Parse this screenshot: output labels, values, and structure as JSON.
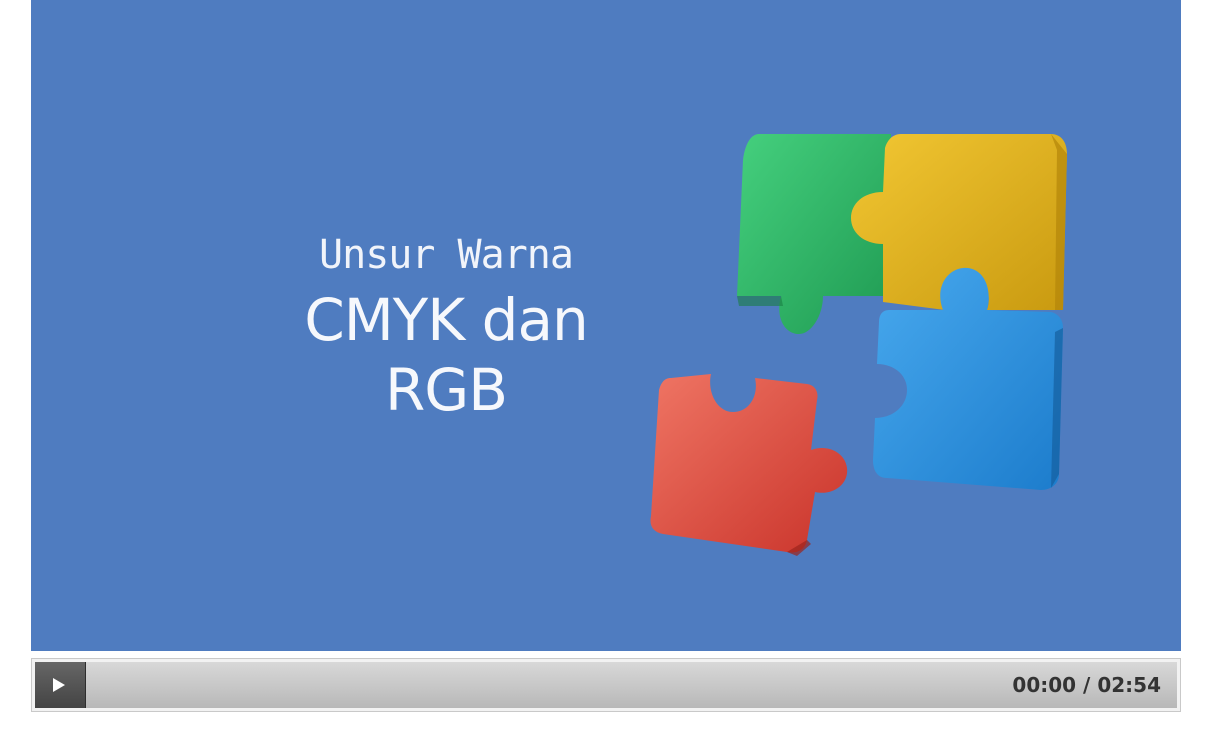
{
  "video": {
    "subtitle": "Unsur Warna",
    "title": "CMYK dan RGB",
    "background_color": "#4f7cc0",
    "graphic": {
      "icon": "puzzle-pieces",
      "piece_colors": [
        "#2fb86a",
        "#e3b21a",
        "#2f93e2",
        "#e0473a"
      ]
    }
  },
  "controls": {
    "play_icon": "play-icon",
    "current_time": "00:00",
    "separator": "/",
    "duration": "02:54",
    "progress": 0.0
  }
}
